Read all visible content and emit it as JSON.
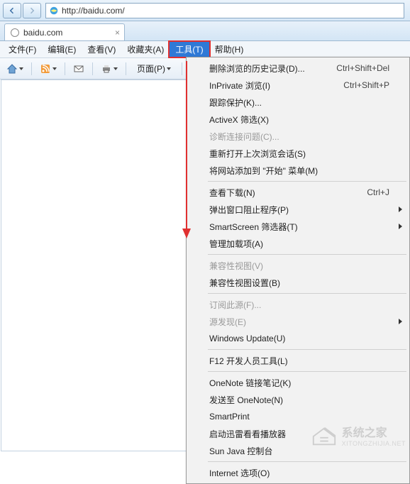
{
  "address_bar": {
    "url": "http://baidu.com/"
  },
  "tab": {
    "title": "baidu.com",
    "close_glyph": "×"
  },
  "menubar": {
    "file": "文件(F)",
    "edit": "编辑(E)",
    "view": "查看(V)",
    "favorites": "收藏夹(A)",
    "tools": "工具(T)",
    "help": "帮助(H)"
  },
  "toolbar": {
    "page_label": "页面(P)"
  },
  "tools_menu": {
    "items": [
      {
        "label": "删除浏览的历史记录(D)...",
        "shortcut": "Ctrl+Shift+Del",
        "disabled": false
      },
      {
        "label": "InPrivate 浏览(I)",
        "shortcut": "Ctrl+Shift+P",
        "disabled": false
      },
      {
        "label": "跟踪保护(K)...",
        "disabled": false
      },
      {
        "label": "ActiveX 筛选(X)",
        "disabled": false
      },
      {
        "label": "诊断连接问题(C)...",
        "disabled": true
      },
      {
        "label": "重新打开上次浏览会话(S)",
        "disabled": false
      },
      {
        "label": "将网站添加到 \"开始\" 菜单(M)",
        "disabled": false
      },
      {
        "sep": true
      },
      {
        "label": "查看下载(N)",
        "shortcut": "Ctrl+J",
        "disabled": false
      },
      {
        "label": "弹出窗口阻止程序(P)",
        "submenu": true,
        "disabled": false
      },
      {
        "label": "SmartScreen 筛选器(T)",
        "submenu": true,
        "disabled": false
      },
      {
        "label": "管理加载项(A)",
        "disabled": false
      },
      {
        "sep": true
      },
      {
        "label": "兼容性视图(V)",
        "disabled": true
      },
      {
        "label": "兼容性视图设置(B)",
        "disabled": false
      },
      {
        "sep": true
      },
      {
        "label": "订阅此源(F)...",
        "disabled": true
      },
      {
        "label": "源发现(E)",
        "submenu": true,
        "disabled": true
      },
      {
        "label": "Windows Update(U)",
        "disabled": false
      },
      {
        "sep": true
      },
      {
        "label": "F12 开发人员工具(L)",
        "disabled": false
      },
      {
        "sep": true
      },
      {
        "label": "OneNote 链接笔记(K)",
        "disabled": false
      },
      {
        "label": "发送至 OneNote(N)",
        "disabled": false
      },
      {
        "label": "SmartPrint",
        "disabled": false
      },
      {
        "label": "启动迅雷看看播放器",
        "disabled": false
      },
      {
        "label": "Sun Java 控制台",
        "disabled": false
      },
      {
        "sep": true
      },
      {
        "label": "Internet 选项(O)",
        "disabled": false
      }
    ]
  },
  "watermark": {
    "title": "系统之家",
    "sub": "XITONGZHIJIA.NET"
  }
}
